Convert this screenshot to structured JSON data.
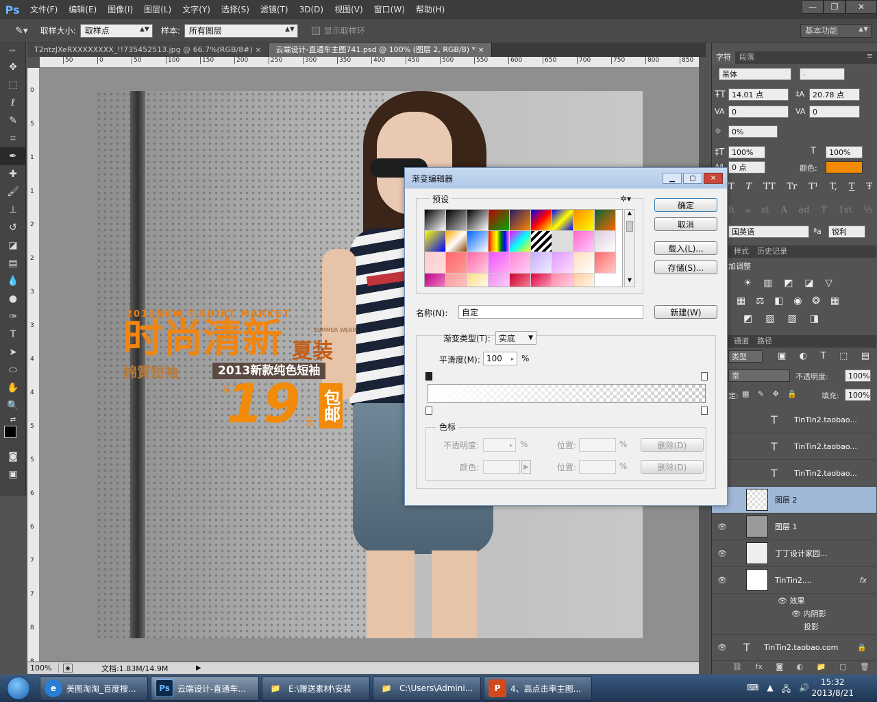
{
  "menubar": {
    "logo": "Ps",
    "items": [
      "文件(F)",
      "编辑(E)",
      "图像(I)",
      "图层(L)",
      "文字(Y)",
      "选择(S)",
      "滤镜(T)",
      "3D(D)",
      "视图(V)",
      "窗口(W)",
      "帮助(H)"
    ],
    "minimize": "—",
    "restore": "❐",
    "close": "✕"
  },
  "options": {
    "sample_size_label": "取样大小:",
    "sample_size_value": "取样点",
    "sample_label": "样本:",
    "sample_value": "所有图层",
    "show_ring_label": "显示取样环",
    "workspace": "基本功能"
  },
  "tabs": [
    {
      "label": "T2ntzJXeRXXXXXXXX_!!735452513.jpg @ 66.7%(RGB/8#)",
      "close": "×"
    },
    {
      "label": "云端设计-直通车主图741.psd @ 100% (图层 2, RGB/8) *",
      "close": "×"
    }
  ],
  "ruler_h": [
    "50",
    "0",
    "50",
    "100",
    "150",
    "200",
    "250",
    "300",
    "350",
    "400",
    "450",
    "500",
    "550",
    "600",
    "650",
    "700",
    "750",
    "800",
    "850"
  ],
  "ruler_v": [
    "0",
    "5",
    "1",
    "1",
    "2",
    "2",
    "3",
    "3",
    "4",
    "4",
    "5",
    "5",
    "6",
    "6",
    "7",
    "7",
    "8",
    "8"
  ],
  "status": {
    "zoom": "100%",
    "doc": "文档:1.83M/14.9M"
  },
  "photo": {
    "small_text": "2013NEW T-SHIRT MARKET",
    "headline": "时尚清新",
    "sub_headline": "夏装",
    "summer": "SUMMER WEAR",
    "bar_left": "棉質短袖",
    "bar_text": "2013新款纯色短袖",
    "price": "19",
    "yen": "¥",
    "yuan": "元",
    "badge": "包邮"
  },
  "char_panel": {
    "tabs": [
      "字符",
      "段落"
    ],
    "font": "黑体",
    "style": "-",
    "size": "14.01 点",
    "leading": "20.78 点",
    "kerning": "0",
    "tracking": "0",
    "scale_label": "0%",
    "vscale": "100%",
    "hscale": "100%",
    "baseline": "0 点",
    "color_label": "颜色:",
    "color": "#f28a00",
    "lang": "国英语",
    "aa_label": "ªa",
    "aa": "锐利",
    "type_styles": [
      "T",
      "T",
      "TT",
      "Tr",
      "T¹",
      "T,",
      "T",
      "Ŧ"
    ],
    "ot_styles": [
      "fi",
      "ℴ",
      "st",
      "A",
      "ad",
      "T",
      "1st",
      "½"
    ]
  },
  "adjust_panel": {
    "tabs": [
      "样式",
      "历史记录"
    ],
    "title": "加调整"
  },
  "layers_panel": {
    "tabs": [
      "通道",
      "路径"
    ],
    "filter": "类型",
    "blend": "常",
    "opacity_label": "不透明度:",
    "opacity": "100%",
    "lock_label": "定:",
    "fill_label": "填充:",
    "fill": "100%",
    "layers": [
      {
        "name": "TinTin2.taobao...",
        "visible": false
      },
      {
        "name": "TinTin2.taobao...",
        "visible": false
      },
      {
        "name": "TinTin2.taobao...",
        "visible": false
      },
      {
        "name": "图层 2",
        "visible": false
      },
      {
        "name": "图层 1",
        "visible": true
      },
      {
        "name": "丁丁设计家园...",
        "visible": true
      },
      {
        "name": "TinTin2....",
        "visible": true
      }
    ],
    "fx": "fx",
    "effects_label": "效果",
    "effects": [
      "内阴影",
      "投影"
    ],
    "bottom_layer": "TinTin2.taobao.com"
  },
  "dialog": {
    "title": "渐变编辑器",
    "preset_label": "预设",
    "ok": "确定",
    "cancel": "取消",
    "load": "载入(L)...",
    "save": "存储(S)...",
    "name_label": "名称(N):",
    "name_value": "自定",
    "new": "新建(W)",
    "type_label": "渐变类型(T):",
    "type_value": "实底",
    "smooth_label": "平滑度(M):",
    "smooth_value": "100",
    "percent": "%",
    "stops_label": "色标",
    "opacity_label": "不透明度:",
    "color_label": "颜色:",
    "location_label": "位置:",
    "delete": "删除(D)"
  },
  "taskbar": {
    "items": [
      {
        "label": "美图淘淘_百度搜...",
        "icon": "e",
        "color": "#2a7fd4"
      },
      {
        "label": "云端设计-直通车...",
        "icon": "Ps",
        "color": "#0b2a4a"
      },
      {
        "label": "E:\\赠送素材\\安装",
        "icon": "📁",
        "color": "#d9a93a"
      },
      {
        "label": "C:\\Users\\Admini...",
        "icon": "📁",
        "color": "#d9a93a"
      },
      {
        "label": "4、高点击率主图...",
        "icon": "P",
        "color": "#d04a1e"
      }
    ],
    "time": "15:32",
    "date": "2013/8/21"
  }
}
